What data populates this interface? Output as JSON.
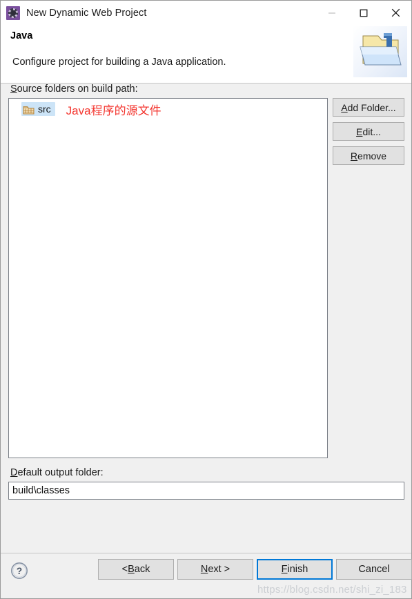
{
  "window": {
    "title": "New Dynamic Web Project",
    "icon": "eclipse-wizard-gear-icon",
    "controls": {
      "minimize": "minimize-icon",
      "maximize": "maximize-icon",
      "close": "close-icon"
    }
  },
  "header": {
    "title": "Java",
    "description": "Configure project for building a Java application.",
    "banner_icon": "java-folder-banner-icon"
  },
  "main": {
    "source_folders_label": "Source folders on build path:",
    "source_folders_mnemonic": "S",
    "source_folders_rest": "ource folders on build path:",
    "list": {
      "items": [
        {
          "label": "src",
          "icon": "source-package-folder-icon",
          "selected": true,
          "annotation": "Java程序的源文件",
          "annotation_color": "#f4362f"
        }
      ]
    },
    "side_buttons": [
      {
        "name": "add-folder-button",
        "mnemonic": "A",
        "rest": "dd Folder..."
      },
      {
        "name": "edit-button",
        "pre": "",
        "mnemonic": "E",
        "rest": "dit..."
      },
      {
        "name": "remove-button",
        "mnemonic": "R",
        "rest": "emove"
      }
    ],
    "output_folder_label_mnemonic": "D",
    "output_folder_label_rest": "efault output folder:",
    "output_folder_value": "build\\classes",
    "output_folder_placeholder": ""
  },
  "footer": {
    "help_icon": "help-question-icon",
    "buttons": [
      {
        "name": "back-button",
        "pre": "< ",
        "mnemonic": "B",
        "rest": "ack",
        "default": false
      },
      {
        "name": "next-button",
        "pre": "",
        "mnemonic": "N",
        "rest": "ext >",
        "default": false
      },
      {
        "name": "finish-button",
        "pre": "",
        "mnemonic": "F",
        "rest": "inish",
        "default": true
      },
      {
        "name": "cancel-button",
        "pre": "",
        "mnemonic": "",
        "rest": "Cancel",
        "default": false
      }
    ]
  },
  "watermark": "https://blog.csdn.net/shi_zi_183",
  "colors": {
    "accent": "#0078d7",
    "selection": "#cce4f7",
    "annotation": "#f4362f",
    "dialog_bg": "#f0f0f0",
    "titlebar_bg": "#ffffff",
    "button_bg": "#e1e1e1"
  }
}
